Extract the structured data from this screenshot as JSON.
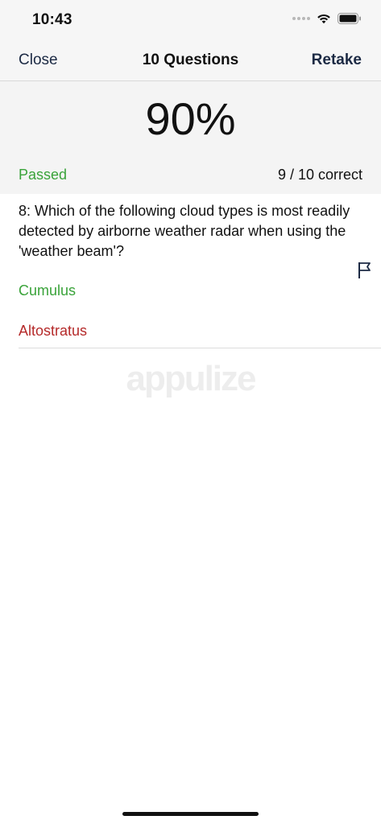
{
  "status_bar": {
    "time": "10:43",
    "icons": [
      "signal-icon",
      "wifi-icon",
      "battery-icon"
    ]
  },
  "nav": {
    "close_label": "Close",
    "title": "10 Questions",
    "retake_label": "Retake"
  },
  "score": {
    "percent": "90%",
    "status": "Passed",
    "correct_summary": "9 / 10 correct"
  },
  "question": {
    "text": "8: Which of the following cloud types is most readily detected by airborne weather radar when using the 'weather beam'?",
    "correct_answer": "Cumulus",
    "selected_wrong_answer": "Altostratus",
    "flag_icon": "flag-icon"
  },
  "watermark": {
    "text": "appulize"
  },
  "colors": {
    "accent_navy": "#1c2a44",
    "pass_green": "#3aa33a",
    "wrong_red": "#b52a2a",
    "header_bg": "#f4f4f4"
  }
}
